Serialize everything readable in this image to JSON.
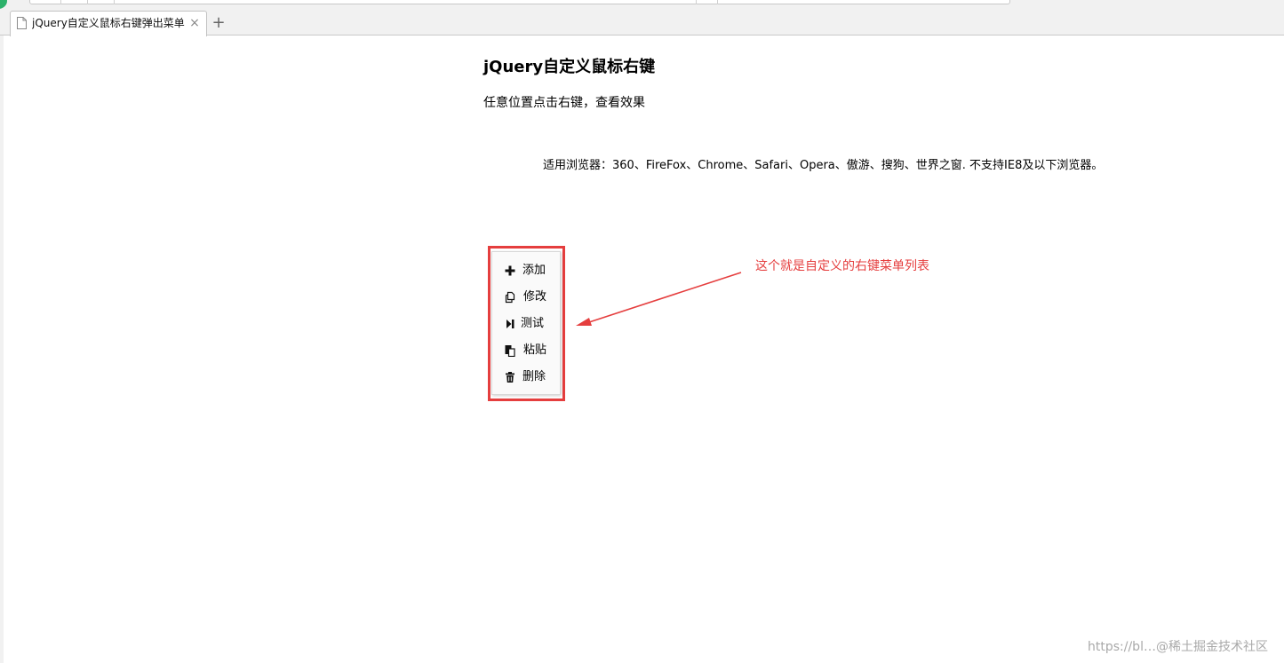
{
  "browser": {
    "tab_title": "jQuery自定义鼠标右键弹出菜单",
    "close_glyph": "×",
    "new_tab_glyph": "+"
  },
  "page": {
    "title": "jQuery自定义鼠标右键",
    "description": "任意位置点击右键，查看效果",
    "browser_note": "适用浏览器：360、FireFox、Chrome、Safari、Opera、傲游、搜狗、世界之窗. 不支持IE8及以下浏览器。"
  },
  "context_menu": {
    "items": [
      {
        "label": "添加",
        "icon": "plus-icon"
      },
      {
        "label": "修改",
        "icon": "copy-icon"
      },
      {
        "label": "测试",
        "icon": "step-forward-icon"
      },
      {
        "label": "粘贴",
        "icon": "paste-icon"
      },
      {
        "label": "删除",
        "icon": "trash-icon"
      }
    ]
  },
  "annotation": {
    "text": "这个就是自定义的右键菜单列表",
    "color": "#e53e3e"
  },
  "watermark": {
    "text": "https://bl…@稀土掘金技术社区"
  }
}
